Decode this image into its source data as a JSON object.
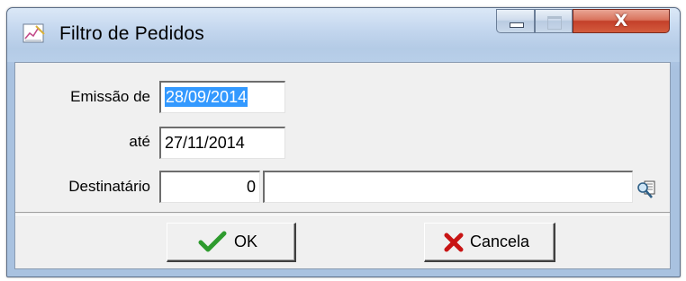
{
  "window": {
    "title": "Filtro de Pedidos",
    "controls": {
      "minimize_icon": "minimize-icon",
      "maximize_icon": "maximize-icon",
      "close_glyph": "X"
    }
  },
  "form": {
    "emissao_label": "Emissão de",
    "emissao_value": "28/09/2014",
    "ate_label": "até",
    "ate_value": "27/11/2014",
    "destinatario_label": "Destinatário",
    "destinatario_code": "0",
    "destinatario_name": ""
  },
  "buttons": {
    "ok_label": "OK",
    "cancel_label": "Cancela"
  },
  "colors": {
    "selection": "#3399ff",
    "ok_check": "#2e9b2e",
    "cancel_x": "#c81414",
    "close_button": "#c4402a"
  }
}
